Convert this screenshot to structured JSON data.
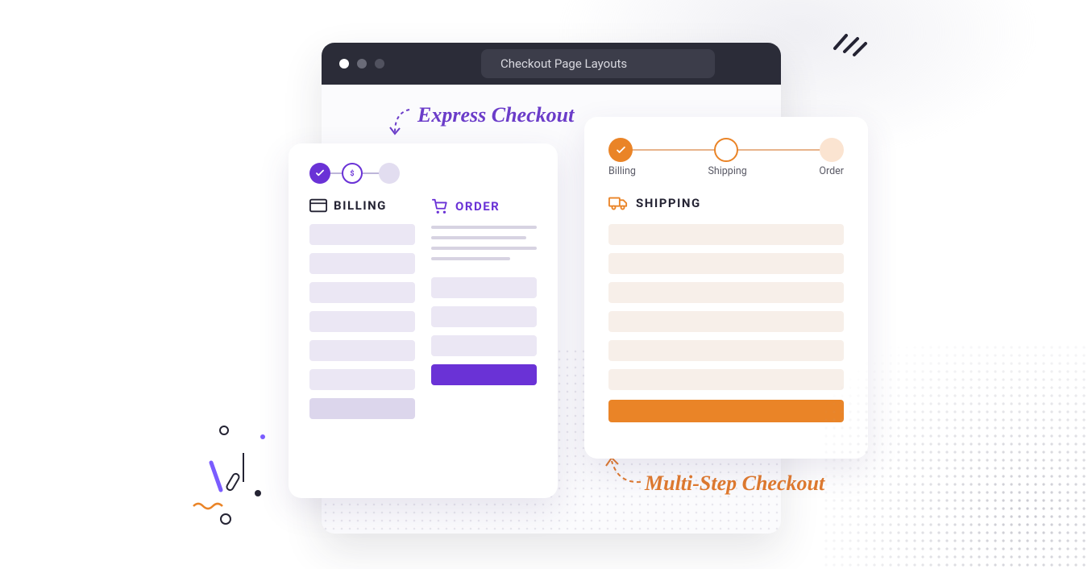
{
  "browser": {
    "title": "Checkout Page Layouts"
  },
  "annotations": {
    "express": "Express Checkout",
    "multi": "Multi-Step Checkout"
  },
  "express_card": {
    "billing_label": "BILLING",
    "order_label": "ORDER"
  },
  "multi_card": {
    "step1": "Billing",
    "step2": "Shipping",
    "step3": "Order",
    "section_label": "SHIPPING"
  }
}
